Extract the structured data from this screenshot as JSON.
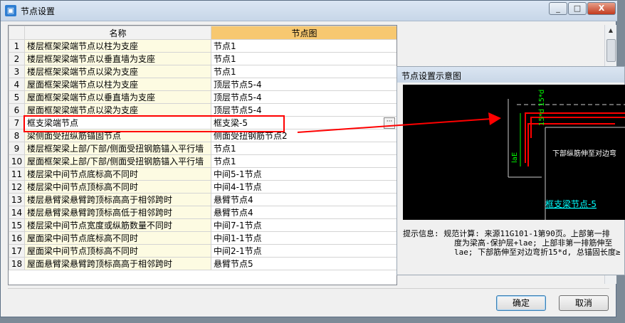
{
  "window": {
    "title": "节点设置"
  },
  "titlebar_buttons": {
    "minimize": "_",
    "maximize": "□",
    "close": "X"
  },
  "grid": {
    "headers": {
      "name": "名称",
      "node_diagram": "节点图"
    },
    "rows": [
      {
        "num": "1",
        "name": "楼层框架梁端节点以柱为支座",
        "node": "节点1"
      },
      {
        "num": "2",
        "name": "楼层框架梁端节点以垂直墙为支座",
        "node": "节点1"
      },
      {
        "num": "3",
        "name": "楼层框架梁端节点以梁为支座",
        "node": "节点1"
      },
      {
        "num": "4",
        "name": "屋面框架梁端节点以柱为支座",
        "node": "顶层节点5-4"
      },
      {
        "num": "5",
        "name": "屋面框架梁端节点以垂直墙为支座",
        "node": "顶层节点5-4"
      },
      {
        "num": "6",
        "name": "屋面框架梁端节点以梁为支座",
        "node": "顶层节点5-4"
      },
      {
        "num": "7",
        "name": "框支梁端节点",
        "node": "框支梁-5"
      },
      {
        "num": "8",
        "name": "梁侧面受扭纵筋锚固节点",
        "node": "侧面受扭钢筋节点2"
      },
      {
        "num": "9",
        "name": "楼层框架梁上部/下部/侧面受扭钢筋锚入平行墙",
        "node": "节点1"
      },
      {
        "num": "10",
        "name": "屋面框架梁上部/下部/侧面受扭钢筋锚入平行墙",
        "node": "节点1"
      },
      {
        "num": "11",
        "name": "楼层梁中间节点底标高不同时",
        "node": "中间5-1节点"
      },
      {
        "num": "12",
        "name": "楼层梁中间节点顶标高不同时",
        "node": "中间4-1节点"
      },
      {
        "num": "13",
        "name": "楼层悬臂梁悬臂跨顶标高高于相邻跨时",
        "node": "悬臂节点4"
      },
      {
        "num": "14",
        "name": "楼层悬臂梁悬臂跨顶标高低于相邻跨时",
        "node": "悬臂节点4"
      },
      {
        "num": "15",
        "name": "楼层梁中间节点宽度或纵筋数量不同时",
        "node": "中间7-1节点"
      },
      {
        "num": "16",
        "name": "屋面梁中间节点底标高不同时",
        "node": "中间1-1节点"
      },
      {
        "num": "17",
        "name": "屋面梁中间节点顶标高不同时",
        "node": "中间2-1节点"
      },
      {
        "num": "18",
        "name": "屋面悬臂梁悬臂跨顶标高高于相邻跨时",
        "node": "悬臂节点5"
      }
    ]
  },
  "popup": {
    "title": "节点设置示意图",
    "diagram": {
      "label_top": "15*d 15*d",
      "label_lae": "laE",
      "label_lae2": "laE",
      "note": "下部纵筋伸至对边弯",
      "caption": "框支梁节点-5"
    },
    "hint": "提示信息: 规范计算: 来源11G101-1第90页。上部第一排",
    "hint2": "度为梁高-保护层+lae; 上部非第一排筋伸至",
    "hint3": "lae; 下部筋伸至对边弯折15*d, 总锚固长度≥"
  },
  "buttons": {
    "ok": "确定",
    "cancel": "取消"
  },
  "colors": {
    "header_highlight": "#f7c870",
    "annotation_red": "#ff0000",
    "diagram_green": "#00ff00",
    "caption_cyan": "#00ffff"
  }
}
